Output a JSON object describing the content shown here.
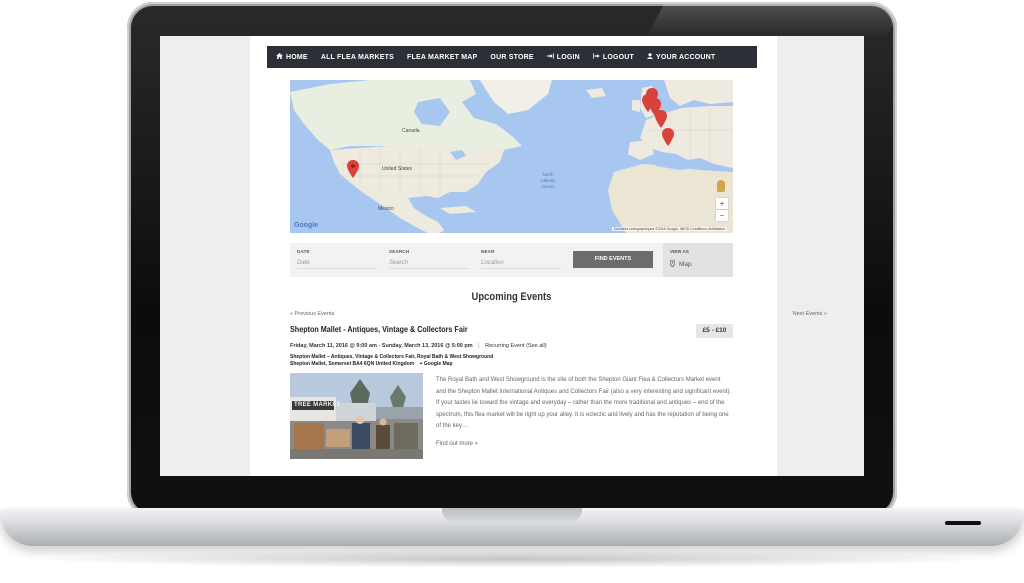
{
  "nav": {
    "items": [
      {
        "label": "HOME",
        "icon": "home-icon"
      },
      {
        "label": "ALL FLEA MARKETS"
      },
      {
        "label": "FLEA MARKET MAP"
      },
      {
        "label": "OUR STORE"
      },
      {
        "label": "LOGIN",
        "icon": "login-icon"
      },
      {
        "label": "LOGOUT",
        "icon": "logout-icon"
      },
      {
        "label": "YOUR ACCOUNT",
        "icon": "user-icon"
      }
    ]
  },
  "map": {
    "brand": "Google",
    "attribution": "Données cartographiques ©2016 Google, INEGI   Conditions d'utilisation",
    "zoom_in": "+",
    "zoom_out": "−",
    "labels": {
      "us": "United States",
      "mexico": "Mexico",
      "canada": "Canada",
      "ocean": "North Atlantic Ocean"
    }
  },
  "filters": {
    "date_label": "DATE",
    "date_placeholder": "Date",
    "search_label": "SEARCH",
    "search_placeholder": "Search",
    "near_label": "NEAR",
    "near_placeholder": "Location",
    "find_button": "FIND EVENTS",
    "view_as_label": "VIEW AS",
    "view_as_value": "Map"
  },
  "events": {
    "heading": "Upcoming Events",
    "prev_link": "« Previous Events",
    "next_link": "Next Events »",
    "title": "Shepton Mallet - Antiques, Vintage & Collectors Fair",
    "price": "£5 - £10",
    "date": "Friday, March 11, 2016 @ 9:00 am - Sunday, March 13, 2016 @ 5:00 pm",
    "recurring": "Recurring Event (See all)",
    "venue_line1": "Shepton Mallet – Antiques, Vintage & Collectors Fair, Royal Bath & West Showground",
    "venue_line2": "Shepton Mallet, Somerset BA4 6QN United Kingdom",
    "google_map_link": "+ Google Map",
    "description": "The Royal Bath and West Showground is the site of both the Shepton Giant Flea & Collectors Market event and the Shepton Mallet International Antiques and Collectors Fair (also a very interesting and significant event). If your tastes lie toward the vintage and everyday – rather than the more traditional and antiques – end of the spectrum, this flea market will be right up your alley. It is eclectic and lively and has the reputation of being one of the key…",
    "find_out_more": "Find out more »",
    "photo_sign": "TREE MARKET"
  },
  "colors": {
    "nav_bg": "#2c2f36",
    "ocean": "#a8c7f0",
    "land": "#efeae0",
    "marker": "#d9413a",
    "button": "#6c6c6c"
  }
}
